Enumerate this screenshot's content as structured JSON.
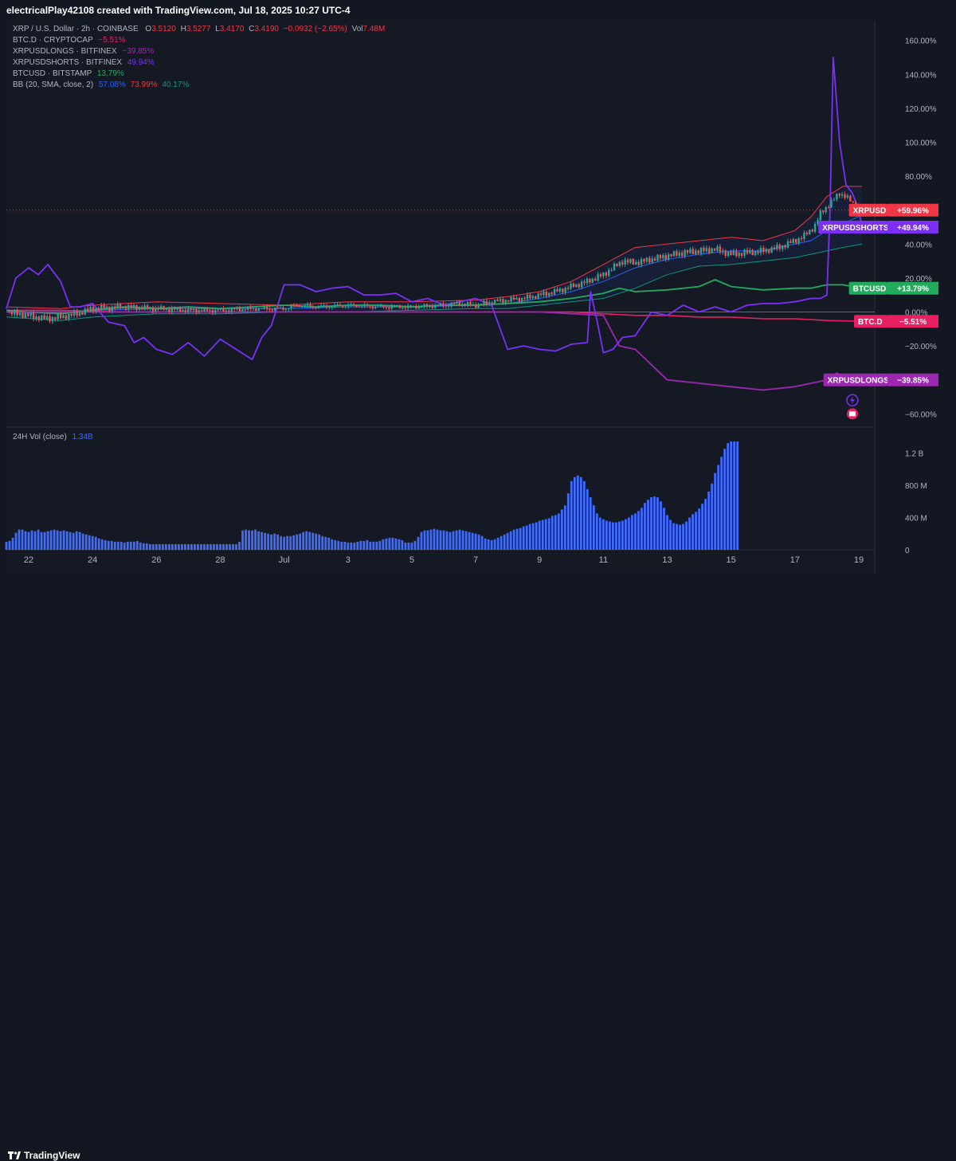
{
  "header": {
    "text": "electricalPlay42108 created with TradingView.com, Jul 18, 2025 10:27 UTC-4"
  },
  "footer": {
    "brand": "TradingView"
  },
  "legend": {
    "main": {
      "title": "XRP / U.S. Dollar · 2h · COINBASE",
      "o_label": "O",
      "o_value": "3.5120",
      "h_label": "H",
      "h_value": "3.5277",
      "l_label": "L",
      "l_value": "3.4170",
      "c_label": "C",
      "c_value": "3.4190",
      "change": "−0.0932 (−2.65%)",
      "vol_label": "Vol",
      "vol_value": "7.48M"
    },
    "btcd": {
      "title": "BTC.D · CRYPTOCAP",
      "value": "−5.51%"
    },
    "longs": {
      "title": "XRPUSDLONGS · BITFINEX",
      "value": "−39.85%"
    },
    "shorts": {
      "title": "XRPUSDSHORTS · BITFINEX",
      "value": "49.94%"
    },
    "btcusd": {
      "title": "BTCUSD · BITSTAMP",
      "value": "13.79%"
    },
    "bb": {
      "title": "BB (20, SMA, close, 2)",
      "v1": "57.08%",
      "v2": "73.99%",
      "v3": "40.17%"
    },
    "vol": {
      "title": "24H Vol (close)",
      "value": "1.34B"
    }
  },
  "price_labels": [
    {
      "name": "XRPUSD",
      "value": "+59.96%",
      "color": "#f23645"
    },
    {
      "name": "XRPUSDSHORTS",
      "value": "+49.94%",
      "color": "#7b2ff7"
    },
    {
      "name": "BTCUSD",
      "value": "+13.79%",
      "color": "#22ab5c"
    },
    {
      "name": "BTC.D",
      "value": "−5.51%",
      "color": "#e91e63"
    },
    {
      "name": "XRPUSDLONGS",
      "value": "−39.85%",
      "color": "#9c27b0"
    }
  ],
  "colors": {
    "xrp_up": "#26a69a",
    "xrp_down": "#ef5350",
    "shorts": "#7b2ff7",
    "longs": "#9c27b0",
    "btcusd": "#22ab5c",
    "btcd": "#e91e63",
    "bb_basis": "#2962ff",
    "bb_upper": "#f23645",
    "bb_lower": "#089981",
    "volume": "#3d6bff"
  },
  "chart_data": [
    {
      "type": "line",
      "title": "XRP / U.S. Dollar · 2h · COINBASE",
      "y_unit": "% change",
      "ylim": [
        -65,
        165
      ],
      "y_ticks": [
        160,
        140,
        120,
        100,
        80,
        60,
        40,
        20,
        0,
        -20,
        -40,
        -60
      ],
      "y_tick_labels": [
        "160.00%",
        "140.00%",
        "120.00%",
        "100.00%",
        "80.00%",
        "60.00%",
        "40.00%",
        "20.00%",
        "0.00%",
        "−20.00%",
        "−40.00%",
        "−60.00%"
      ],
      "x_ticks": [
        "22",
        "24",
        "26",
        "28",
        "Jul",
        "3",
        "5",
        "7",
        "9",
        "11",
        "13",
        "15",
        "17",
        "19"
      ],
      "x_tick_pos": [
        22,
        24,
        26,
        28,
        30,
        32,
        34,
        36,
        38,
        40,
        42,
        44,
        46,
        48
      ],
      "xlim": [
        21.3,
        48.5
      ],
      "series": [
        {
          "name": "XRPUSD",
          "key": "xrp",
          "x": [
            21.3,
            22,
            22.5,
            23,
            23.5,
            24,
            25,
            26,
            27,
            28,
            29,
            30,
            30.5,
            31,
            32,
            33,
            34,
            35,
            35.5,
            36,
            36.5,
            37,
            37.5,
            38,
            38.5,
            39,
            39.5,
            40,
            40.3,
            40.6,
            41,
            41.5,
            42,
            42.5,
            43,
            43.5,
            44,
            44.5,
            45,
            45.5,
            46,
            46.3,
            46.6,
            46.8,
            47,
            47.2,
            47.4,
            47.6,
            47.8,
            48.0,
            48.1
          ],
          "y": [
            0,
            -2,
            -4,
            -3,
            -1,
            2,
            3,
            2,
            1,
            1,
            2,
            2,
            4,
            3,
            4,
            3,
            3,
            4,
            5,
            4,
            6,
            7,
            8,
            10,
            12,
            15,
            18,
            22,
            26,
            30,
            29,
            31,
            33,
            35,
            36,
            37,
            34,
            35,
            36,
            38,
            42,
            45,
            50,
            58,
            62,
            66,
            70,
            68,
            64,
            62,
            60
          ]
        },
        {
          "name": "BB upper",
          "key": "bb_upper",
          "x": [
            21.3,
            23,
            24,
            26,
            28,
            30,
            32,
            34,
            36,
            37,
            38,
            39,
            40,
            41,
            42,
            43,
            44,
            45,
            46,
            46.5,
            47,
            47.5,
            48.1
          ],
          "y": [
            3,
            2,
            4,
            6,
            5,
            4,
            6,
            6,
            7,
            9,
            12,
            18,
            28,
            38,
            40,
            42,
            44,
            42,
            48,
            56,
            68,
            74,
            74
          ]
        },
        {
          "name": "BB basis",
          "key": "bb_basis",
          "x": [
            21.3,
            23,
            24,
            26,
            28,
            30,
            32,
            34,
            36,
            37,
            38,
            39,
            40,
            41,
            42,
            43,
            44,
            45,
            46,
            46.5,
            47,
            47.5,
            48.1
          ],
          "y": [
            0,
            -1,
            1,
            2,
            2,
            2,
            3,
            3,
            4,
            5,
            8,
            12,
            18,
            26,
            31,
            34,
            36,
            36,
            40,
            42,
            48,
            52,
            57
          ]
        },
        {
          "name": "BB lower",
          "key": "bb_lower",
          "x": [
            21.3,
            23,
            24,
            26,
            28,
            30,
            32,
            34,
            36,
            37,
            38,
            39,
            40,
            41,
            42,
            43,
            44,
            45,
            46,
            46.5,
            47,
            47.5,
            48.1
          ],
          "y": [
            -3,
            -5,
            -3,
            -1,
            -1,
            0,
            0,
            1,
            2,
            2,
            4,
            6,
            8,
            14,
            22,
            27,
            28,
            30,
            32,
            34,
            36,
            38,
            40
          ]
        },
        {
          "name": "BTCUSD",
          "key": "btcusd",
          "x": [
            21.3,
            22,
            23,
            24,
            25,
            26,
            27,
            28,
            29,
            30,
            31,
            32,
            33,
            34,
            35,
            36,
            37,
            38,
            39,
            40,
            40.5,
            41,
            42,
            43,
            43.5,
            44,
            45,
            46,
            46.5,
            47,
            47.5,
            48.1
          ],
          "y": [
            1,
            0,
            -1,
            1,
            3,
            2,
            3,
            2,
            3,
            4,
            3,
            4,
            4,
            3,
            4,
            4,
            5,
            6,
            8,
            11,
            14,
            12,
            13,
            15,
            19,
            15,
            13,
            14,
            14,
            16,
            16,
            14
          ]
        },
        {
          "name": "BTC.D",
          "key": "btcd",
          "x": [
            21.3,
            23,
            25,
            27,
            29,
            31,
            33,
            35,
            37,
            39,
            40,
            41,
            42,
            43,
            44,
            45,
            46,
            47,
            48.1
          ],
          "y": [
            1,
            1,
            0,
            0,
            0,
            0,
            0,
            0,
            0,
            0,
            -1,
            -2,
            -2,
            -3,
            -3,
            -4,
            -4,
            -5,
            -5.5
          ]
        },
        {
          "name": "XRPUSDSHORTS",
          "key": "shorts",
          "x": [
            21.3,
            21.6,
            22,
            22.3,
            22.6,
            23,
            23.3,
            23.6,
            24,
            24.5,
            25,
            25.3,
            25.6,
            26,
            26.5,
            27,
            27.5,
            28,
            28.5,
            29,
            29.3,
            29.6,
            30,
            30.5,
            31,
            31.5,
            32,
            32.5,
            33,
            33.5,
            34,
            34.5,
            35,
            35.5,
            36,
            36.5,
            37,
            37.5,
            38,
            38.5,
            39,
            39.5,
            39.6,
            39.8,
            40,
            40.3,
            40.6,
            41,
            41.5,
            42,
            42.5,
            43,
            43.5,
            44,
            44.5,
            45,
            45.5,
            46,
            46.5,
            46.8,
            47,
            47.1,
            47.2,
            47.4,
            47.6,
            47.8,
            48.0,
            48.1
          ],
          "y": [
            2,
            20,
            26,
            22,
            28,
            18,
            3,
            3,
            5,
            -6,
            -8,
            -18,
            -15,
            -22,
            -25,
            -18,
            -26,
            -16,
            -22,
            -28,
            -15,
            -8,
            16,
            16,
            12,
            14,
            15,
            10,
            10,
            11,
            6,
            8,
            4,
            6,
            8,
            4,
            -22,
            -20,
            -22,
            -23,
            -19,
            -18,
            12,
            -5,
            -24,
            -22,
            -15,
            -14,
            0,
            -2,
            4,
            0,
            3,
            0,
            4,
            5,
            5,
            6,
            8,
            8,
            10,
            60,
            150,
            100,
            75,
            70,
            60,
            50
          ]
        },
        {
          "name": "XRPUSDLONGS",
          "key": "longs",
          "x": [
            21.3,
            24,
            26,
            28,
            30,
            32,
            34,
            36,
            38,
            40,
            40.5,
            41,
            42,
            43,
            44,
            45,
            46,
            47,
            47.3,
            47.6,
            48.1
          ],
          "y": [
            0,
            0,
            0,
            0,
            0,
            0,
            0,
            0,
            0,
            -2,
            -20,
            -22,
            -40,
            -42,
            -44,
            -46,
            -44,
            -40,
            -36,
            -38,
            -40
          ]
        }
      ]
    },
    {
      "type": "bar",
      "title": "24H Vol (close)",
      "ylim": [
        0,
        1400
      ],
      "y_ticks": [
        0,
        400,
        800,
        1200
      ],
      "y_tick_labels": [
        "0",
        "400 M",
        "800 M",
        "1.2 B"
      ],
      "xlim": [
        21.3,
        48.5
      ],
      "x_from": 21.3,
      "x_step": 0.1,
      "values": [
        100,
        110,
        150,
        210,
        250,
        250,
        230,
        220,
        240,
        230,
        250,
        220,
        220,
        230,
        240,
        250,
        240,
        230,
        240,
        230,
        220,
        210,
        230,
        220,
        200,
        190,
        180,
        170,
        160,
        140,
        130,
        120,
        110,
        110,
        100,
        100,
        100,
        90,
        100,
        100,
        100,
        110,
        90,
        80,
        80,
        70,
        70,
        70,
        70,
        70,
        70,
        70,
        70,
        70,
        70,
        70,
        70,
        70,
        70,
        70,
        70,
        70,
        70,
        70,
        70,
        70,
        70,
        70,
        70,
        70,
        70,
        70,
        70,
        100,
        240,
        250,
        240,
        240,
        250,
        230,
        220,
        210,
        200,
        190,
        200,
        190,
        170,
        160,
        170,
        170,
        180,
        190,
        200,
        220,
        230,
        220,
        210,
        200,
        190,
        170,
        160,
        150,
        130,
        120,
        110,
        100,
        100,
        90,
        90,
        90,
        100,
        110,
        110,
        120,
        100,
        100,
        100,
        110,
        130,
        140,
        150,
        150,
        140,
        130,
        120,
        90,
        90,
        90,
        110,
        160,
        220,
        240,
        240,
        250,
        260,
        250,
        240,
        240,
        230,
        220,
        230,
        240,
        250,
        240,
        230,
        220,
        210,
        200,
        190,
        170,
        140,
        130,
        120,
        130,
        150,
        170,
        190,
        210,
        230,
        250,
        260,
        270,
        290,
        300,
        320,
        330,
        340,
        360,
        370,
        380,
        390,
        420,
        430,
        450,
        500,
        550,
        700,
        850,
        900,
        920,
        900,
        850,
        750,
        650,
        550,
        450,
        400,
        380,
        360,
        350,
        340,
        340,
        350,
        360,
        380,
        400,
        430,
        450,
        480,
        520,
        580,
        620,
        650,
        660,
        650,
        600,
        520,
        430,
        370,
        330,
        320,
        310,
        320,
        350,
        400,
        440,
        470,
        510,
        570,
        630,
        720,
        820,
        950,
        1050,
        1150,
        1250,
        1320,
        1340,
        1340,
        1340
      ]
    }
  ]
}
